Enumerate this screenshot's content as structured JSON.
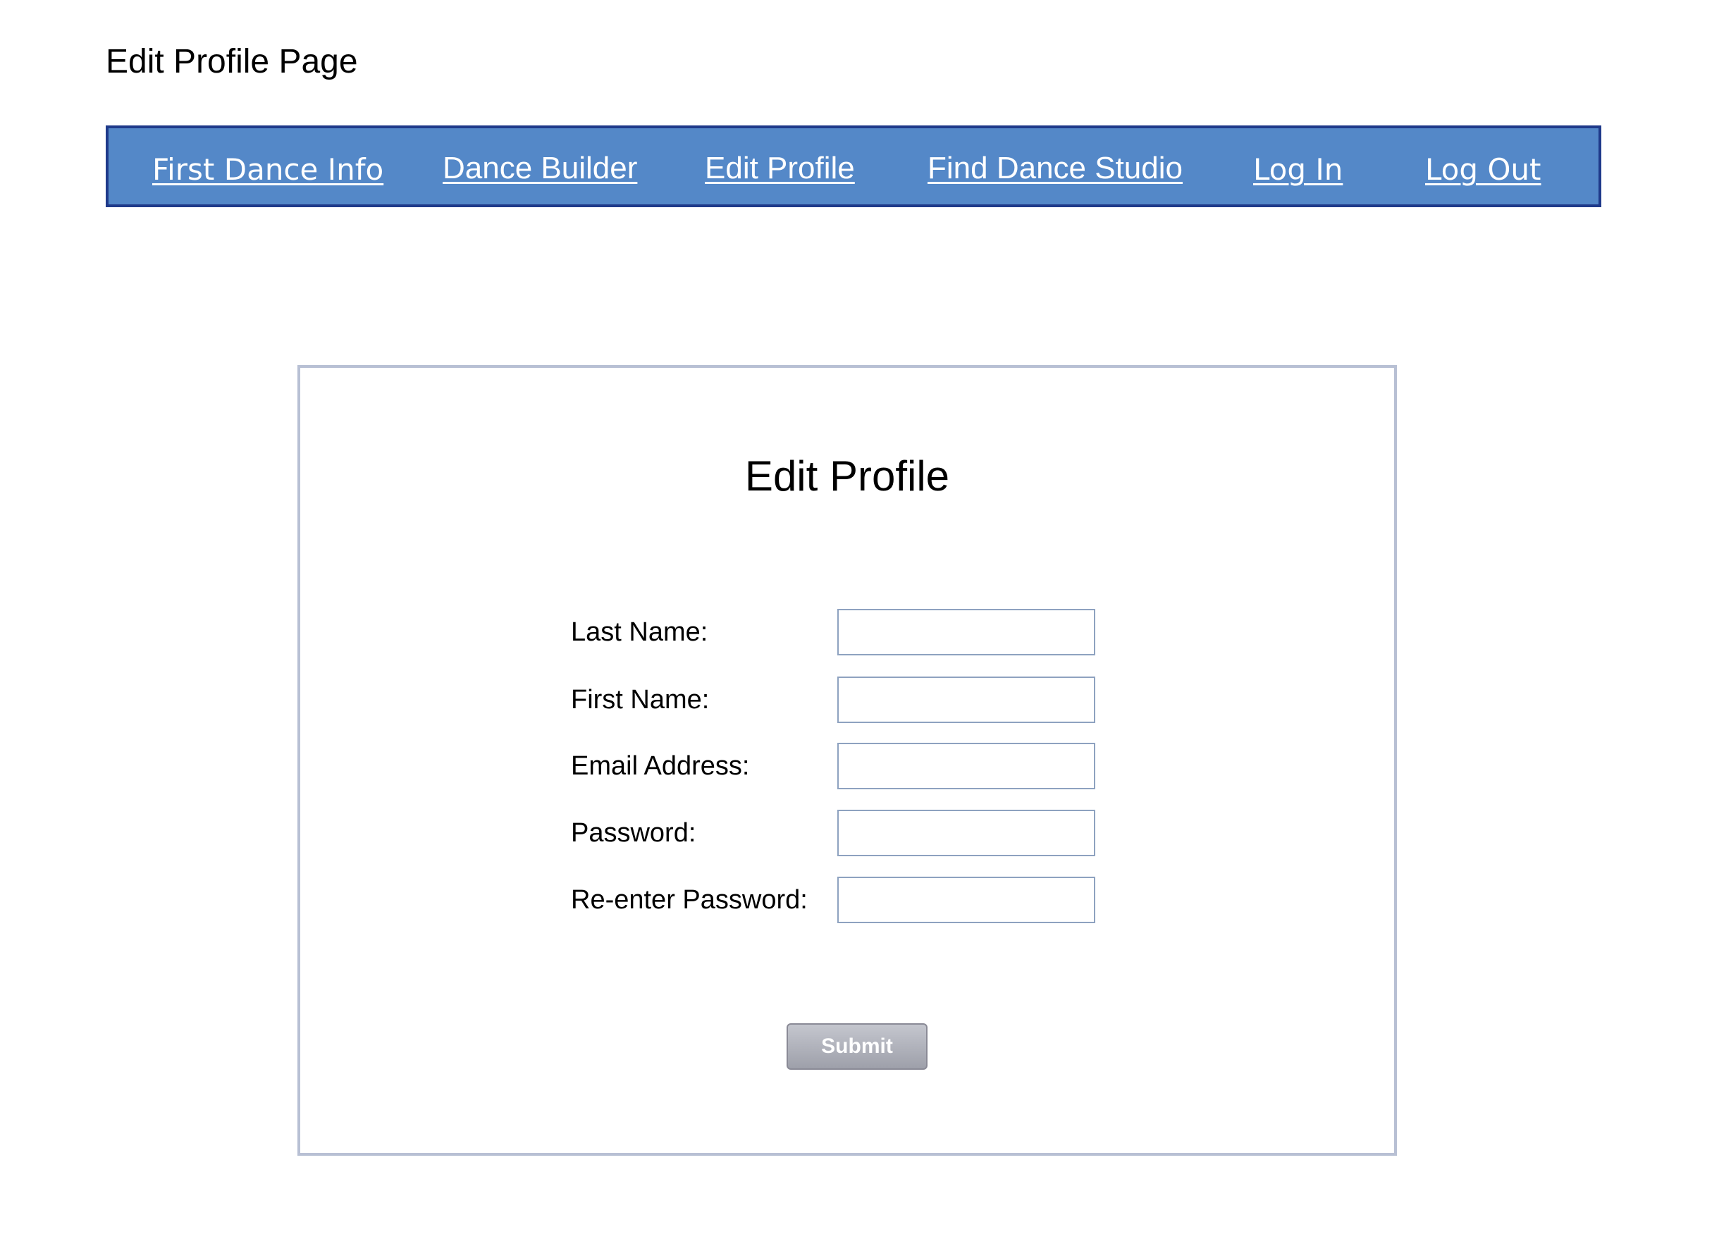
{
  "page": {
    "title": "Edit Profile Page"
  },
  "nav": {
    "items": [
      {
        "label": "First Dance Info"
      },
      {
        "label": "Dance Builder"
      },
      {
        "label": "Edit Profile"
      },
      {
        "label": "Find Dance Studio"
      },
      {
        "label": "Log In"
      },
      {
        "label": "Log Out"
      }
    ],
    "bar_color": "#5488c8",
    "border_color": "#1f3a8a",
    "link_color": "#ffffff"
  },
  "form": {
    "heading": "Edit Profile",
    "fields": [
      {
        "label": "Last Name:",
        "value": "",
        "placeholder": ""
      },
      {
        "label": "First Name:",
        "value": "",
        "placeholder": ""
      },
      {
        "label": "Email Address:",
        "value": "",
        "placeholder": ""
      },
      {
        "label": "Password:",
        "value": "",
        "placeholder": ""
      },
      {
        "label": "Re-enter Password:",
        "value": "",
        "placeholder": ""
      }
    ],
    "submit_label": "Submit"
  }
}
